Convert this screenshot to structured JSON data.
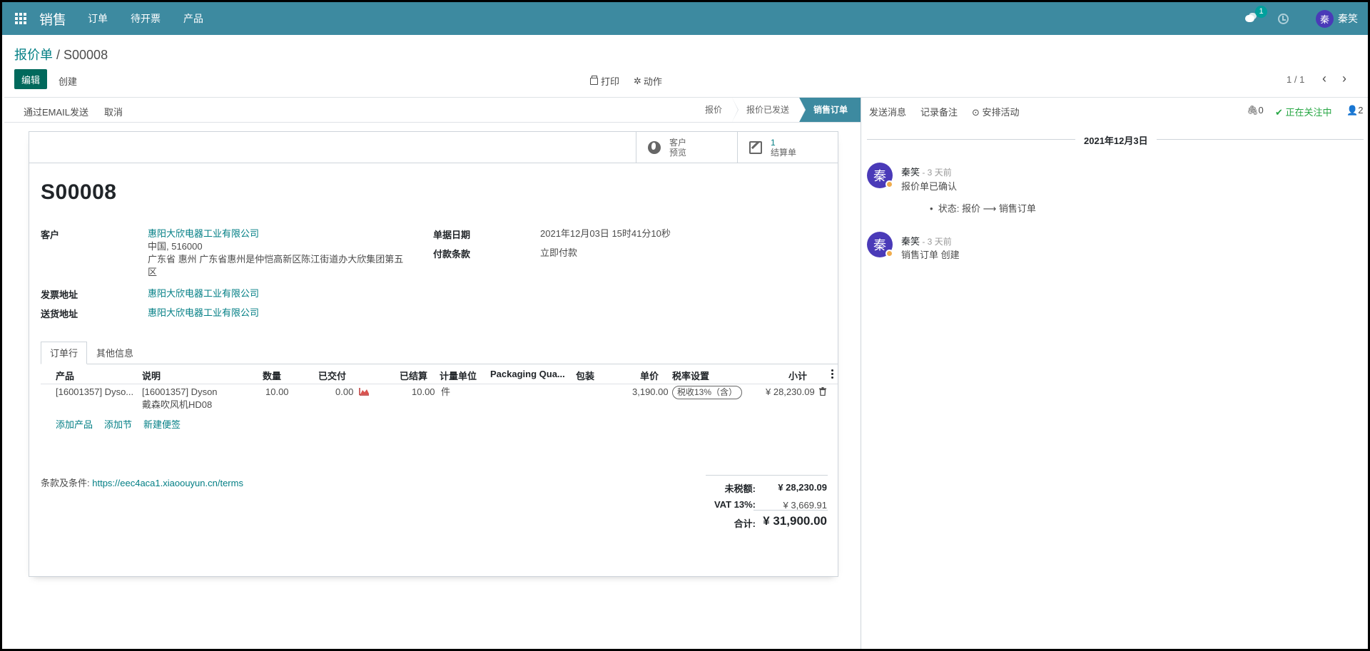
{
  "navbar": {
    "brand": "销售",
    "menus": [
      "订单",
      "待开票",
      "产品"
    ],
    "chat_badge": "1",
    "user_initial": "秦",
    "user_name": "秦笑"
  },
  "control": {
    "breadcrumb_parent": "报价单",
    "breadcrumb_sep": " / ",
    "breadcrumb_current": "S00008",
    "edit_label": "编辑",
    "create_label": "创建",
    "print_label": "打印",
    "action_label": "动作",
    "pager": "1 / 1",
    "prev": "‹",
    "next": "›"
  },
  "statusbar": {
    "email_btn": "通过EMAIL发送",
    "cancel_btn": "取消",
    "stages": [
      "报价",
      "报价已发送",
      "销售订单"
    ]
  },
  "smart_buttons": {
    "preview_line1": "客户",
    "preview_line2": "预览",
    "invoice_count": "1",
    "invoice_label": "结算单"
  },
  "form": {
    "name": "S00008",
    "customer_label": "客户",
    "customer_name": "惠阳大欣电器工业有限公司",
    "customer_addr1": "中国, 516000",
    "customer_addr2": "广东省 惠州 广东省惠州是仲恺高新区陈江街道办大欣集团第五",
    "customer_addr3": "区",
    "invoice_addr_label": "发票地址",
    "invoice_addr": "惠阳大欣电器工业有限公司",
    "delivery_addr_label": "送货地址",
    "delivery_addr": "惠阳大欣电器工业有限公司",
    "date_label": "单据日期",
    "date_value": "2021年12月03日 15时41分10秒",
    "payment_label": "付款条款",
    "payment_value": "立即付款"
  },
  "tabs": [
    "订单行",
    "其他信息"
  ],
  "lines": {
    "headers": [
      "产品",
      "说明",
      "数量",
      "已交付",
      "已结算",
      "计量单位",
      "Packaging Qua...",
      "包装",
      "单价",
      "税率设置",
      "小计"
    ],
    "row": {
      "product": "[16001357] Dyso...",
      "desc1": "[16001357] Dyson",
      "desc2": "戴森吹风机HD08",
      "qty": "10.00",
      "delivered": "0.00",
      "invoiced": "10.00",
      "uom": "件",
      "price": "3,190.00",
      "tax": "税收13%（含）",
      "subtotal": "¥ 28,230.09"
    },
    "add_product": "添加产品",
    "add_section": "添加节",
    "add_note": "新建便签"
  },
  "terms": {
    "label": "条款及条件: ",
    "url": "https://eec4aca1.xiaoouyun.cn/terms"
  },
  "totals": {
    "untaxed_label": "未税额:",
    "untaxed": "¥ 28,230.09",
    "vat_label": "VAT 13%:",
    "vat": "¥ 3,669.91",
    "total_label": "合计:",
    "total": "¥ 31,900.00"
  },
  "chatter": {
    "send_msg": "发送消息",
    "log_note": "记录备注",
    "schedule": "安排活动",
    "attachments": "0",
    "following": "正在关注中",
    "followers": "2",
    "date_sep": "2021年12月3日",
    "messages": [
      {
        "initial": "秦",
        "author": "秦笑",
        "time": " - 3 天前",
        "body": "报价单已确认",
        "tracking": "状态: 报价 ⟶ 销售订单"
      },
      {
        "initial": "秦",
        "author": "秦笑",
        "time": " - 3 天前",
        "body": "销售订单 创建"
      }
    ]
  },
  "colors": {
    "navbar": "#3d8aa0",
    "primary_btn": "#00695c",
    "link": "#017e84",
    "avatar": "#4a3ab8"
  }
}
